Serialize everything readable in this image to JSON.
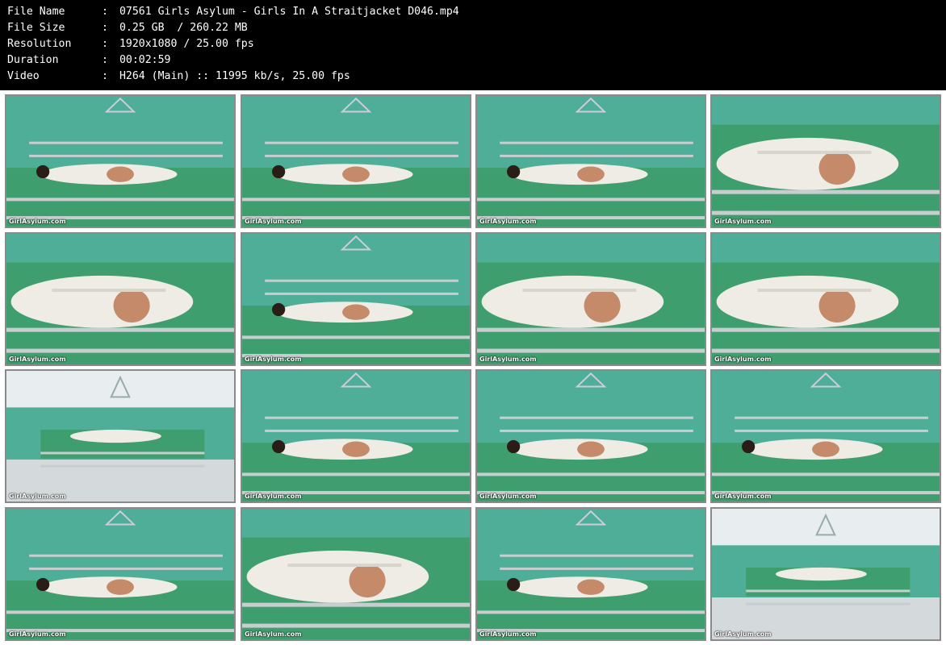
{
  "metadata": {
    "rows": [
      {
        "key": "File Name",
        "sep": ":",
        "value": "07561 Girls Asylum - Girls In A Straitjacket D046.mp4"
      },
      {
        "key": "File Size",
        "sep": ":",
        "value": "0.25 GB  / 260.22 MB"
      },
      {
        "key": "Resolution",
        "sep": ":",
        "value": "1920x1080 / 25.00 fps"
      },
      {
        "key": "Duration",
        "sep": ":",
        "value": "00:02:59"
      },
      {
        "key": "Video",
        "sep": ":",
        "value": "H264 (Main) :: 11995 kb/s, 25.00 fps"
      }
    ]
  },
  "thumbnails": {
    "watermark": "GirlAsylum.com",
    "count": 16,
    "colors": {
      "wall": "#4fae98",
      "mattress": "#3f9e6e",
      "bed_frame": "#c8cdd0",
      "straitjacket": "#eeece4",
      "skin": "#c48a6a",
      "hair": "#2a1d17",
      "white_wall": "#e8eef0"
    }
  }
}
